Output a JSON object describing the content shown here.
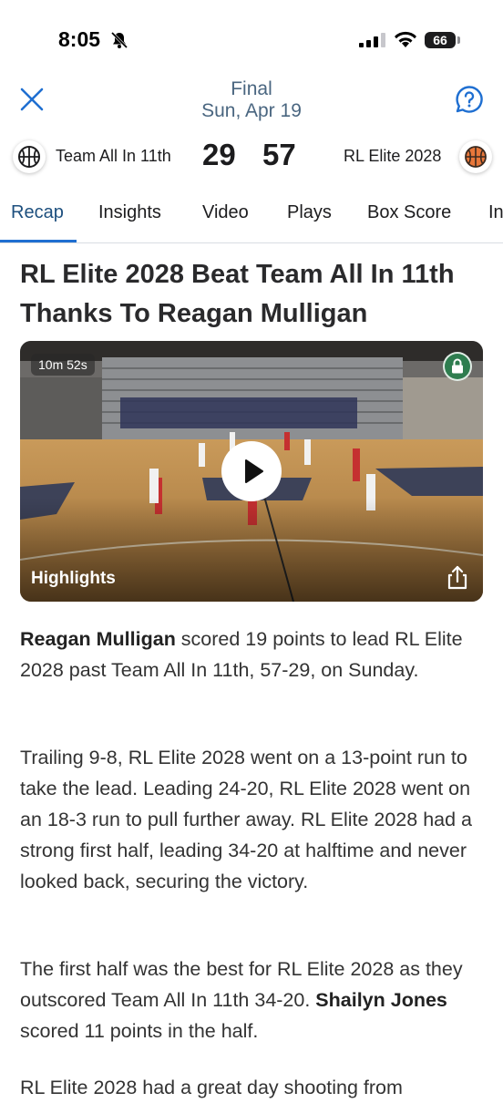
{
  "status_bar": {
    "time": "8:05",
    "battery": "66"
  },
  "header": {
    "status": "Final",
    "date": "Sun, Apr 19"
  },
  "scoreboard": {
    "home": {
      "name": "Team All In 11th",
      "score": "29"
    },
    "away": {
      "name": "RL Elite 2028",
      "score": "57"
    }
  },
  "tabs": [
    {
      "label": "Recap",
      "active": true
    },
    {
      "label": "Insights"
    },
    {
      "label": "Video"
    },
    {
      "label": "Plays"
    },
    {
      "label": "Box Score"
    },
    {
      "label": "In"
    }
  ],
  "article": {
    "headline": "RL Elite 2028 Beat Team All In 11th Thanks To Reagan Mulligan",
    "video": {
      "duration": "10m 52s",
      "label": "Highlights"
    },
    "p1": {
      "bold": "Reagan Mulligan",
      "text": " scored 19 points to lead RL Elite 2028 past Team All In 11th, 57-29, on Sunday."
    },
    "p2": "Trailing 9-8, RL Elite 2028 went on a 13-point run to take the lead. Leading 24-20, RL Elite 2028 went on an 18-3 run to pull further away. RL Elite 2028 had a strong first half, leading 34-20 at halftime and never looked back, securing the victory.",
    "p3": {
      "text_before": "The first half was the best for RL Elite 2028 as they outscored Team All In 11th 34-20. ",
      "bold": "Shailyn Jones",
      "text_after": " scored 11 points in the half."
    },
    "p4": "RL Elite 2028 had a great day shooting from"
  }
}
